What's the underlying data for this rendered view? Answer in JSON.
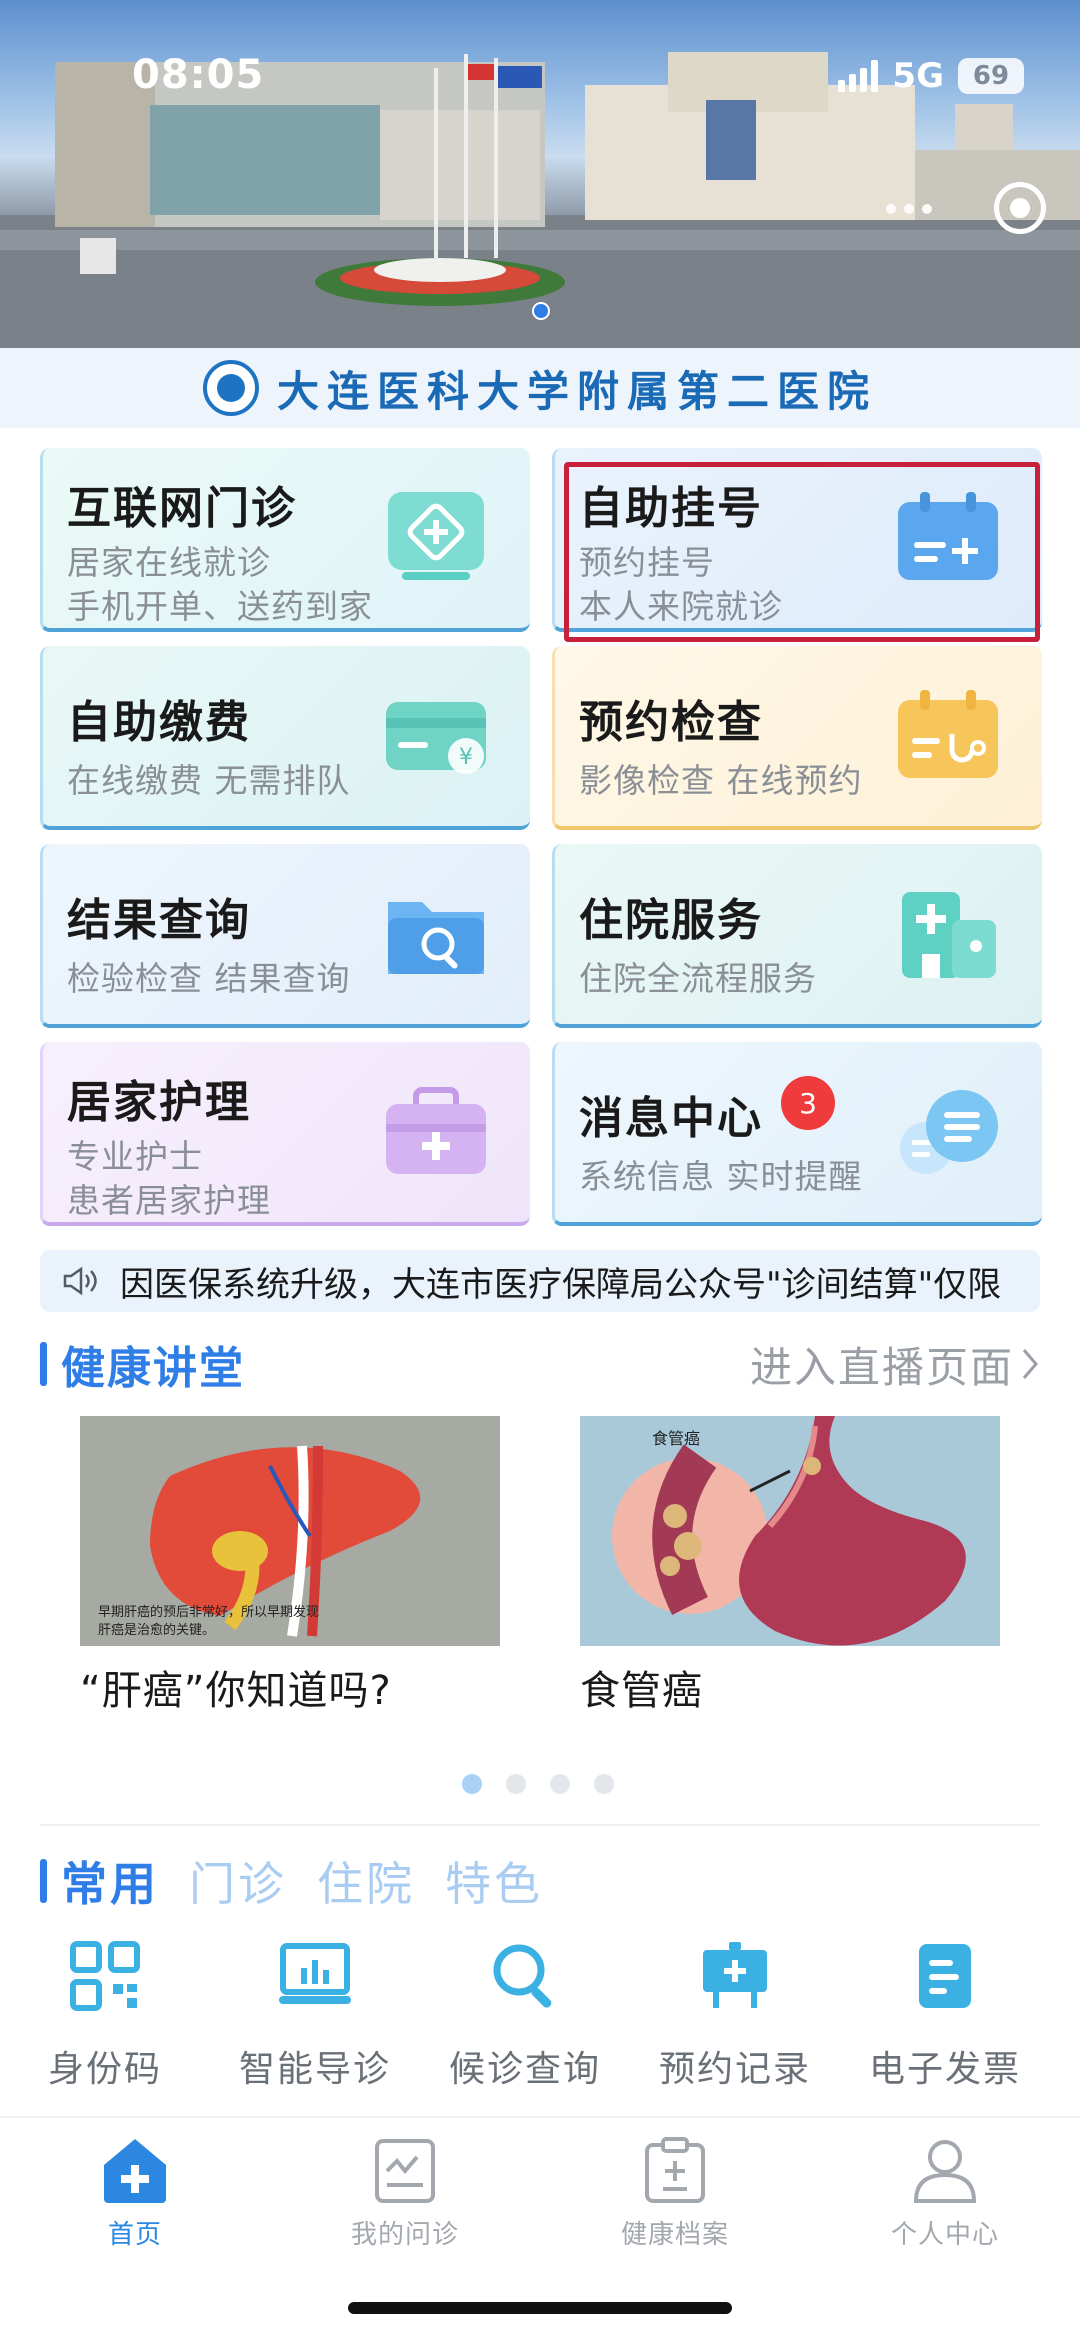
{
  "status_bar": {
    "time": "08:05",
    "network": "5G",
    "battery": "69"
  },
  "hospital": {
    "name": "大连医科大学附属第二医院"
  },
  "services": [
    {
      "title": "互联网门诊",
      "sub1": "居家在线就诊",
      "sub2": "手机开单、送药到家",
      "icon": "hospital-cross-icon"
    },
    {
      "title": "自助挂号",
      "sub1": "预约挂号",
      "sub2": "本人来院就诊",
      "icon": "registration-card-icon"
    },
    {
      "title": "自助缴费",
      "sub1": "在线缴费 无需排队",
      "icon": "payment-card-icon"
    },
    {
      "title": "预约检查",
      "sub1": "影像检查 在线预约",
      "icon": "exam-calendar-icon"
    },
    {
      "title": "结果查询",
      "sub1": "检验检查 结果查询",
      "icon": "folder-search-icon"
    },
    {
      "title": "住院服务",
      "sub1": "住院全流程服务",
      "icon": "hospital-building-icon"
    },
    {
      "title": "居家护理",
      "sub1": "专业护士",
      "sub2": "患者居家护理",
      "icon": "medical-kit-icon"
    },
    {
      "title": "消息中心",
      "sub1": "系统信息 实时提醒",
      "badge": "3",
      "icon": "chat-bubble-icon"
    }
  ],
  "notice": {
    "text": "因医保系统升级，大连市医疗保障局公众号\"诊间结算\"仅限"
  },
  "lecture_section": {
    "title": "健康讲堂",
    "more": "进入直播页面",
    "items": [
      {
        "title": "“肝癌”你知道吗?",
        "caption_line1": "早期肝癌的预后非常好，所以早期发现",
        "caption_line2": "肝癌是治愈的关键。"
      },
      {
        "title": "食管癌",
        "caption": "食管癌"
      }
    ]
  },
  "tabs": {
    "items": [
      "常用",
      "门诊",
      "住院",
      "特色"
    ],
    "active": "常用"
  },
  "tools": [
    {
      "label": "身份码",
      "icon": "qr-code-icon"
    },
    {
      "label": "智能导诊",
      "icon": "guide-screen-icon"
    },
    {
      "label": "候诊查询",
      "icon": "search-icon"
    },
    {
      "label": "预约记录",
      "icon": "record-board-icon"
    },
    {
      "label": "电子发票",
      "icon": "invoice-icon"
    }
  ],
  "bottom_nav": [
    {
      "label": "首页",
      "icon": "home-plus-icon",
      "active": true
    },
    {
      "label": "我的问诊",
      "icon": "consultation-icon"
    },
    {
      "label": "健康档案",
      "icon": "health-record-icon"
    },
    {
      "label": "个人中心",
      "icon": "user-icon"
    }
  ],
  "colors": {
    "accent": "#2f7ee8",
    "highlight": "#c8203a",
    "badge": "#ef3b3b"
  }
}
